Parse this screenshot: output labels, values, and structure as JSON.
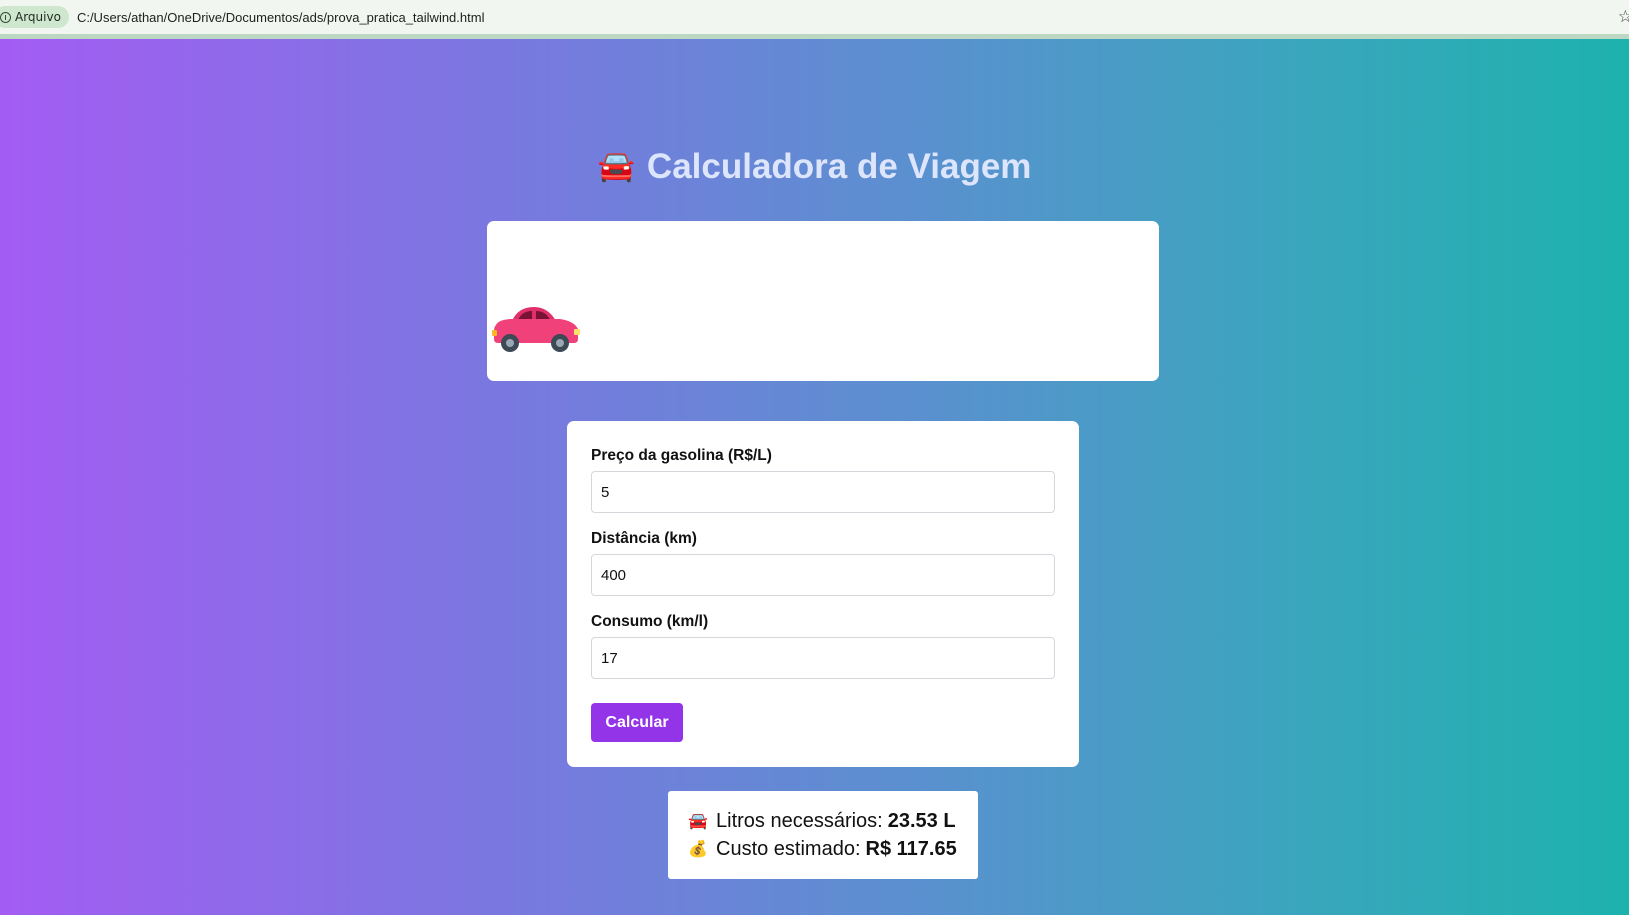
{
  "browser": {
    "site_chip_label": "Arquivo",
    "url": "C:/Users/athan/OneDrive/Documentos/ads/prova_pratica_tailwind.html",
    "bookmark_icon": "star-icon"
  },
  "page": {
    "title": "Calculadora de Viagem",
    "title_icon": "🚘",
    "gradient_colors": [
      "#a35cf3",
      "#1db2ad"
    ]
  },
  "animation": {
    "car_icon": "car-icon",
    "car_color": "#f0417b"
  },
  "form": {
    "fields": [
      {
        "label": "Preço da gasolina (R$/L)",
        "value": "5"
      },
      {
        "label": "Distância (km)",
        "value": "400"
      },
      {
        "label": "Consumo (km/l)",
        "value": "17"
      }
    ],
    "submit_label": "Calcular",
    "accent_color": "#9334e9"
  },
  "result": {
    "liters_icon": "🚘",
    "liters_label": "Litros necessários:",
    "liters_value": "23.53 L",
    "cost_icon": "💰",
    "cost_label": "Custo estimado:",
    "cost_value": "R$ 117.65"
  }
}
